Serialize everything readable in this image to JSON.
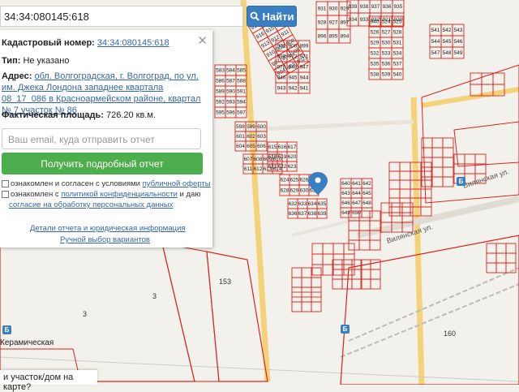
{
  "search": {
    "value": "34:34:080145:618",
    "button_label": "Найти"
  },
  "info": {
    "cadastral_label": "Кадастровый номер:",
    "cadastral_value": "34:34:080145:618",
    "type_label": "Тип:",
    "type_value": "Не указано",
    "address_label": "Адрес:",
    "address_value": "обл. Волгоградская, г. Волгоград, по ул. им. Джека Лондона западнее квартала 08_17_086 в Красноармейском районе, квартал № 7 участок № 86",
    "area_label": "Фактическая площадь:",
    "area_value": "726.20 кв.м."
  },
  "email": {
    "placeholder": "Ваш email, куда отправить отчет"
  },
  "report_button": "Получить подробный отчет",
  "consent1": {
    "prefix": "ознакомлен и согласен с условиями ",
    "link": "публичной оферты"
  },
  "consent2": {
    "prefix": "ознакомлен с ",
    "link1": "политикой конфиденциальности",
    "middle": " и даю",
    "link2": "согласие на обработку персональных данных"
  },
  "details_link": "Детали отчета и юридическая информация",
  "manual_link": "Ручной выбор вариантов",
  "bottom_question": "и участок/дом на карте?",
  "map_labels": {
    "street1": "Вилянская ул.",
    "street2": "Вилянская ул.",
    "poi_keramicheskaya": "Керамическая",
    "n153": "153",
    "n3a": "3",
    "n3b": "3",
    "n160": "160"
  },
  "parcel_numbers": [
    "931",
    "930",
    "929",
    "928",
    "927",
    "897",
    "896",
    "895",
    "894",
    "939",
    "938",
    "937",
    "936",
    "935",
    "934",
    "933",
    "932",
    "921",
    "920",
    "919",
    "918",
    "917",
    "916",
    "915",
    "914",
    "913",
    "912",
    "911",
    "910",
    "909",
    "908",
    "907",
    "906",
    "905",
    "904",
    "903",
    "902",
    "901",
    "900",
    "899",
    "898",
    "972",
    "971",
    "970",
    "948",
    "947",
    "946",
    "945",
    "944",
    "943",
    "942",
    "941",
    "940",
    "524",
    "525",
    "526",
    "527",
    "528",
    "529",
    "530",
    "531",
    "532",
    "533",
    "534",
    "535",
    "536",
    "537",
    "538",
    "539",
    "540",
    "541",
    "542",
    "543",
    "544",
    "545",
    "546",
    "547",
    "548",
    "549",
    "583",
    "584",
    "585",
    "586",
    "587",
    "588",
    "589",
    "590",
    "591",
    "592",
    "593",
    "594",
    "595",
    "596",
    "597",
    "598",
    "599",
    "600",
    "601",
    "602",
    "603",
    "604",
    "605",
    "606",
    "607",
    "608",
    "609",
    "610",
    "611",
    "612",
    "613",
    "614",
    "615",
    "616",
    "617",
    "618",
    "619",
    "620",
    "621",
    "622",
    "623",
    "624",
    "625",
    "626",
    "627",
    "628",
    "629",
    "630",
    "631",
    "632",
    "633",
    "634",
    "635",
    "636",
    "637",
    "638",
    "639",
    "640",
    "641",
    "642",
    "643",
    "644",
    "645",
    "646",
    "647",
    "648",
    "649",
    "650"
  ],
  "colors": {
    "accent": "#3a7fc1",
    "green": "#4cae4c",
    "parcel": "#d9251c",
    "road": "#f4d27a"
  }
}
